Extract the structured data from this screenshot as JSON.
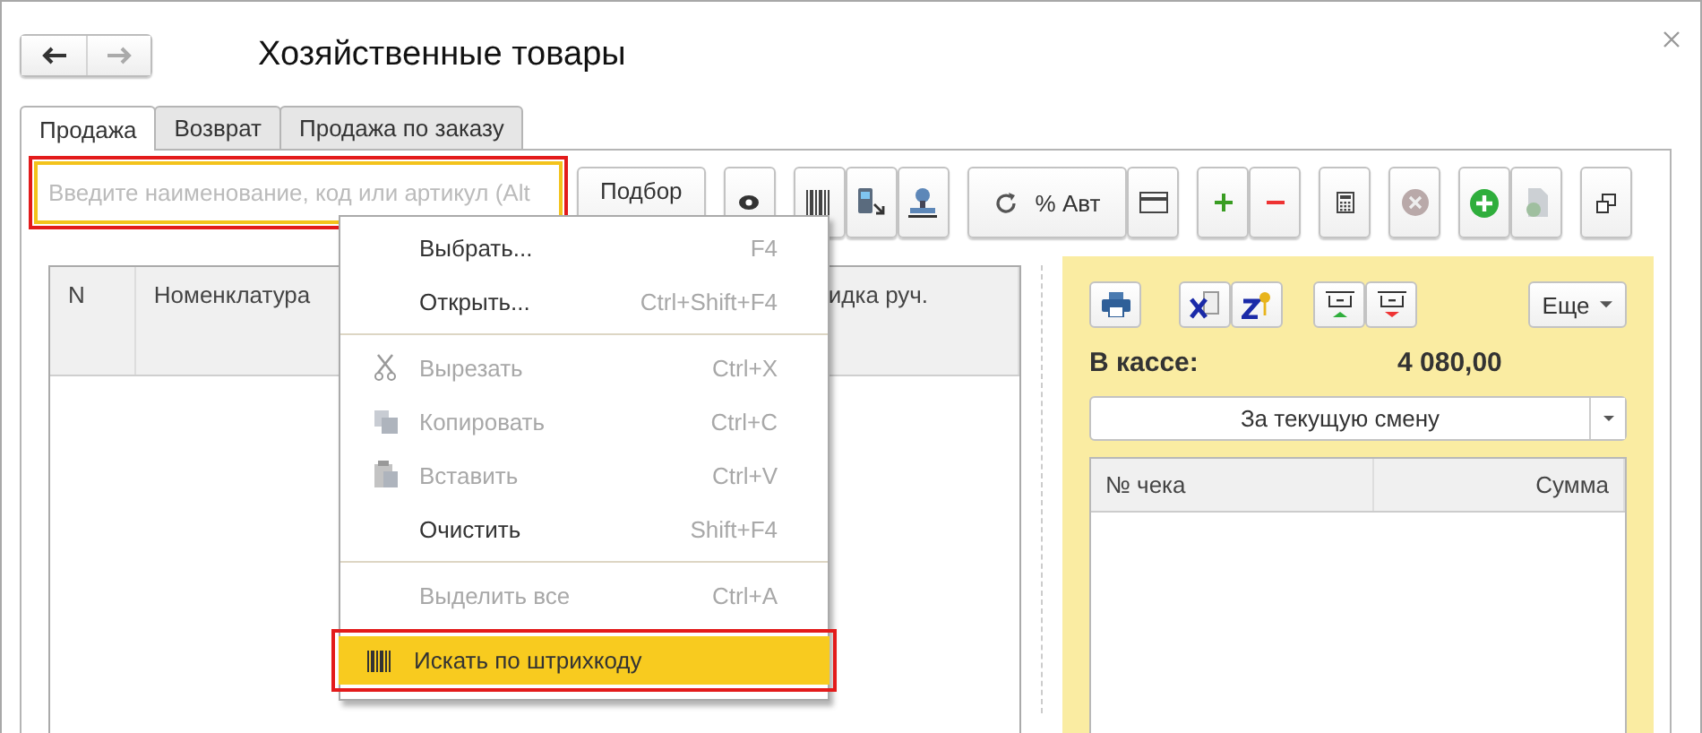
{
  "window": {
    "title": "Хозяйственные товары"
  },
  "tabs": [
    {
      "label": "Продажа",
      "selected": true
    },
    {
      "label": "Возврат",
      "selected": false
    },
    {
      "label": "Продажа по заказу",
      "selected": false
    }
  ],
  "search": {
    "placeholder": "Введите наименование, код или артикул (Alt"
  },
  "toolbar": {
    "pick_button": "Подбор",
    "discount_button": "% Авт"
  },
  "goods_table": {
    "columns": [
      "N",
      "Номенклатура",
      "идка руч."
    ]
  },
  "context_menu": [
    {
      "kind": "command",
      "label": "Выбрать...",
      "shortcut": "F4",
      "disabled": false,
      "selected": false
    },
    {
      "kind": "command",
      "label": "Открыть...",
      "shortcut": "Ctrl+Shift+F4",
      "disabled": false,
      "selected": false
    },
    {
      "kind": "separator"
    },
    {
      "kind": "cut",
      "label": "Вырезать",
      "shortcut": "Ctrl+X",
      "disabled": true,
      "selected": false
    },
    {
      "kind": "copy",
      "label": "Копировать",
      "shortcut": "Ctrl+C",
      "disabled": true,
      "selected": false
    },
    {
      "kind": "paste",
      "label": "Вставить",
      "shortcut": "Ctrl+V",
      "disabled": true,
      "selected": false
    },
    {
      "kind": "command",
      "label": "Очистить",
      "shortcut": "Shift+F4",
      "disabled": false,
      "selected": false
    },
    {
      "kind": "separator"
    },
    {
      "kind": "command",
      "label": "Выделить все",
      "shortcut": "Ctrl+A",
      "disabled": true,
      "selected": false
    },
    {
      "kind": "barcode",
      "label": "Искать по штрихкоду",
      "disabled": false,
      "selected": true
    }
  ],
  "cash_panel": {
    "more_button": "Еще",
    "cash_label": "В кассе:",
    "cash_value": "4 080,00",
    "period": "За текущую смену",
    "columns": [
      "№ чека",
      "Сумма"
    ]
  }
}
